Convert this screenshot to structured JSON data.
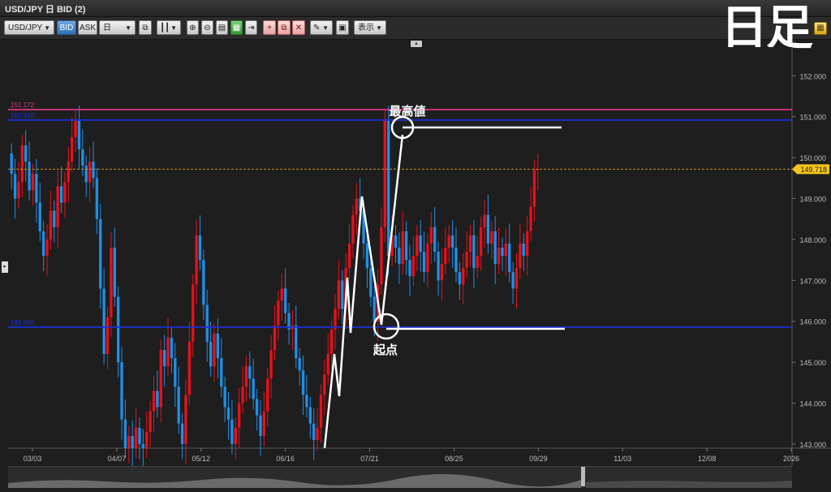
{
  "window": {
    "title": "USD/JPY 日 BID (2)"
  },
  "overlay_title": "日足",
  "toolbar": {
    "symbol": "USD/JPY",
    "bid_label": "BID",
    "ask_label": "ASK",
    "period": "日",
    "display_label": "表示",
    "chart_type_icon": "candlestick-icon",
    "zoom_in_icon": "zoom-in-icon",
    "zoom_out_icon": "zoom-out-icon"
  },
  "annotations": {
    "peak_label": "最高値",
    "start_label": "起点"
  },
  "colors": {
    "background": "#1e1e1e",
    "up": "#e8101a",
    "down": "#1e8fe8",
    "high_line": "#e0338a",
    "blue_line": "#1d2fd6",
    "current_price": "#f5c518",
    "annotation": "#ffffff"
  },
  "chart_data": {
    "type": "candlestick",
    "symbol": "USD/JPY",
    "period": "daily",
    "price_axis": {
      "min": 142.9,
      "max": 152.7,
      "ticks": [
        "152.000",
        "151.000",
        "150.000",
        "149.000",
        "148.000",
        "147.000",
        "146.000",
        "145.000",
        "144.000",
        "143.000"
      ]
    },
    "date_axis": {
      "ticks": [
        "03/03",
        "04/07",
        "05/12",
        "06/16",
        "07/21",
        "08/25",
        "09/29",
        "11/03",
        "12/08",
        "2026"
      ]
    },
    "horizontal_lines": [
      {
        "label": "151.172",
        "value": 151.172,
        "color": "#e0338a"
      },
      {
        "label": "150.918",
        "value": 150.918,
        "color": "#1d2fd6"
      },
      {
        "label": "145.858",
        "value": 145.858,
        "color": "#1d2fd6"
      }
    ],
    "current_price": {
      "label": "149.718",
      "value": 149.718
    },
    "closes": [
      149.6,
      149.0,
      149.4,
      150.3,
      149.9,
      149.2,
      149.6,
      148.9,
      148.2,
      147.6,
      148.0,
      148.7,
      148.3,
      149.3,
      148.9,
      149.4,
      149.9,
      150.5,
      150.9,
      150.2,
      149.8,
      149.4,
      149.9,
      149.5,
      148.5,
      146.8,
      145.2,
      146.1,
      147.8,
      146.6,
      145.0,
      143.6,
      142.9,
      143.2,
      142.9,
      143.4,
      143.0,
      142.9,
      143.3,
      143.8,
      144.3,
      143.9,
      145.3,
      144.9,
      145.6,
      145.1,
      144.4,
      143.5,
      143.0,
      144.2,
      145.5,
      146.9,
      148.1,
      147.5,
      146.4,
      145.5,
      144.9,
      145.7,
      145.1,
      144.4,
      143.9,
      143.6,
      143.0,
      143.4,
      144.0,
      144.4,
      144.9,
      144.6,
      144.1,
      143.7,
      143.2,
      143.8,
      144.6,
      145.3,
      145.9,
      146.5,
      146.8,
      146.2,
      145.8,
      145.9,
      145.1,
      144.8,
      144.2,
      143.9,
      143.5,
      143.1,
      143.4,
      144.2,
      144.7,
      145.2,
      145.8,
      146.3,
      147.0,
      146.3,
      147.3,
      147.9,
      148.6,
      149.0,
      148.7,
      147.9,
      147.3,
      146.6,
      146.0,
      146.9,
      148.3,
      150.9,
      147.6,
      148.1,
      147.8,
      147.4,
      148.2,
      147.5,
      147.1,
      147.6,
      148.1,
      147.7,
      147.2,
      147.9,
      148.3,
      147.7,
      147.0,
      147.4,
      147.8,
      148.1,
      147.8,
      147.2,
      146.9,
      147.3,
      147.7,
      148.1,
      147.3,
      147.6,
      148.3,
      148.6,
      147.9,
      148.2,
      147.4,
      147.8,
      147.6,
      147.9,
      147.2,
      146.8,
      147.3,
      147.9,
      147.6,
      148.2,
      148.8,
      149.7,
      149.72
    ]
  }
}
